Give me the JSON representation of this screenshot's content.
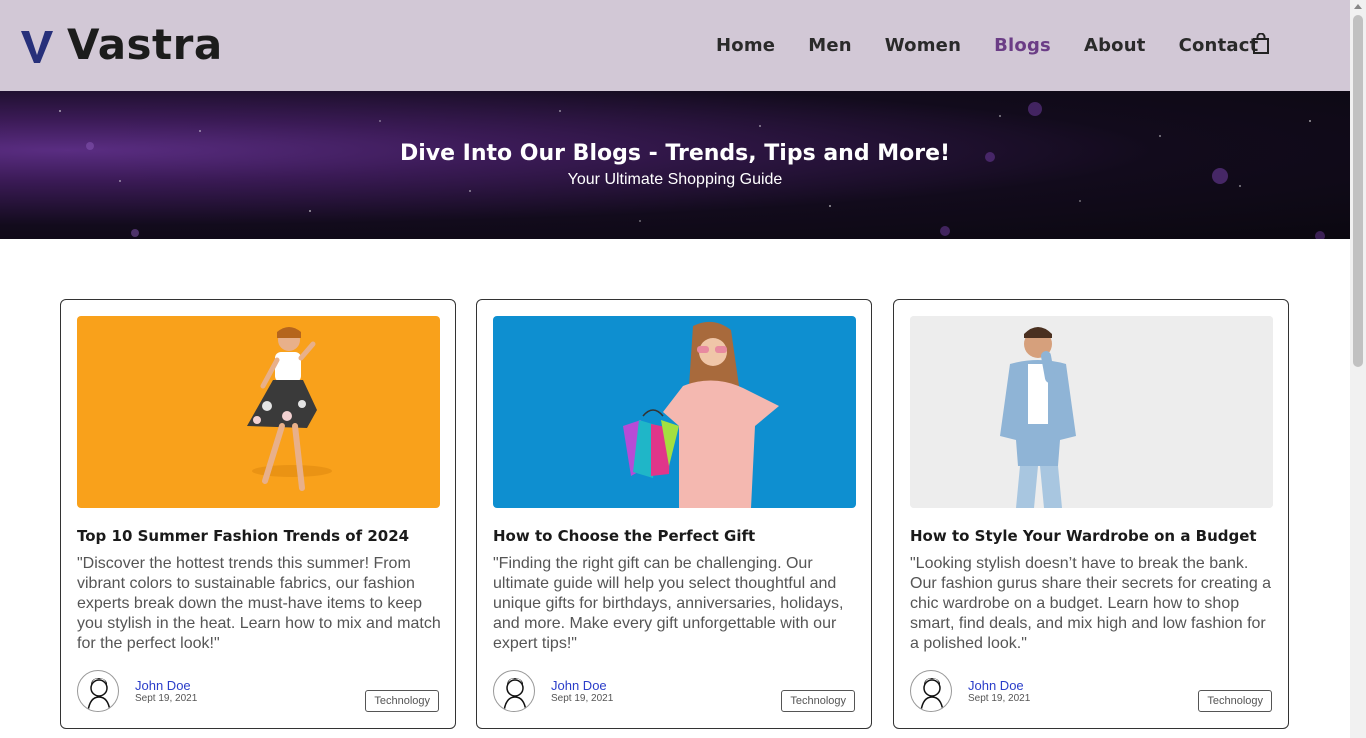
{
  "brand": {
    "name": "Vastra",
    "accent": "#6b3d86",
    "logo_color": "#27307a"
  },
  "nav": {
    "items": [
      {
        "label": "Home",
        "active": false
      },
      {
        "label": "Men",
        "active": false
      },
      {
        "label": "Women",
        "active": false
      },
      {
        "label": "Blogs",
        "active": true
      },
      {
        "label": "About",
        "active": false
      },
      {
        "label": "Contact",
        "active": false
      }
    ],
    "cart_icon": "shopping-bag-icon"
  },
  "hero": {
    "title": "Dive Into Our Blogs - Trends, Tips and More!",
    "subtitle": "Your Ultimate Shopping Guide"
  },
  "cards": [
    {
      "title": "Top 10 Summer Fashion Trends of 2024",
      "text": "\"Discover the hottest trends this summer! From vibrant colors to sustainable fabrics, our fashion experts break down the must-have items to keep you stylish in the heat. Learn how to mix and match for the perfect look!\"",
      "author": "John Doe",
      "date": "Sept 19, 2021",
      "tag": "Technology",
      "image_bg": "#f9a11b"
    },
    {
      "title": "How to Choose the Perfect Gift",
      "text": "\"Finding the right gift can be challenging. Our ultimate guide will help you select thoughtful and unique gifts for birthdays, anniversaries, holidays, and more. Make every gift unforgettable with our expert tips!\"",
      "author": "John Doe",
      "date": "Sept 19, 2021",
      "tag": "Technology",
      "image_bg": "#0e8fd0"
    },
    {
      "title": "How to Style Your Wardrobe on a Budget",
      "text": "\"Looking stylish doesn’t have to break the bank. Our fashion gurus share their secrets for creating a chic wardrobe on a budget. Learn how to shop smart, find deals, and mix high and low fashion for a polished look.\"",
      "author": "John Doe",
      "date": "Sept 19, 2021",
      "tag": "Technology",
      "image_bg": "#e6e6e6"
    }
  ]
}
